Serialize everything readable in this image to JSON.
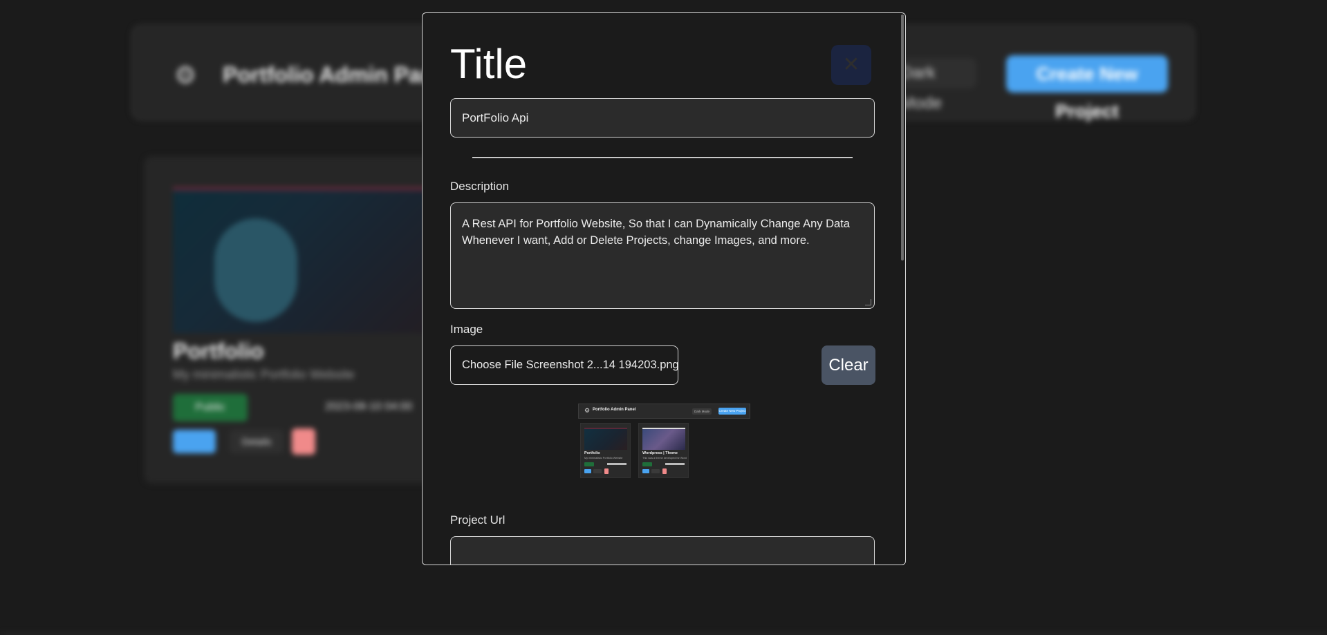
{
  "background": {
    "app_title": "Portfolio Admin Panel",
    "dark_mode_label": "Dark Mode",
    "create_button_label": "Create New Project",
    "project_card": {
      "title": "Portfolio",
      "description": "My minimalistic Portfolio Website",
      "status_badge": "Public",
      "date": "2023-08-10 04:00",
      "edit_label": "Edit",
      "details_label": "Details"
    }
  },
  "modal": {
    "heading": "Title",
    "close_symbol": "✕",
    "title_value": "PortFolio Api",
    "description_label": "Description",
    "description_value": "A Rest API for Portfolio Website, So that I can Dynamically Change Any Data Whenever I want, Add or Delete Projects, change Images, and more.",
    "image_label": "Image",
    "file_button_label": "Choose File",
    "file_name": "Screenshot 2...14 194203.png",
    "clear_label": "Clear",
    "project_url_label": "Project Url",
    "project_url_value": "",
    "preview": {
      "app_title": "Portfolio Admin Panel",
      "dark_mode_label": "Dark Mode",
      "create_label": "Create New Project",
      "cards": [
        {
          "title": "Portfolio",
          "description": "My minimalistic Portfolio Website"
        },
        {
          "title": "Wordpress | Theme",
          "description": "This was a theme developed for WordPress"
        }
      ]
    }
  },
  "colors": {
    "page_background": "#1b1b1b",
    "accent_blue": "#4aa3f0",
    "public_green": "#1f6e3a",
    "delete_red": "#f08a8a",
    "clear_button": "#4a5464"
  }
}
